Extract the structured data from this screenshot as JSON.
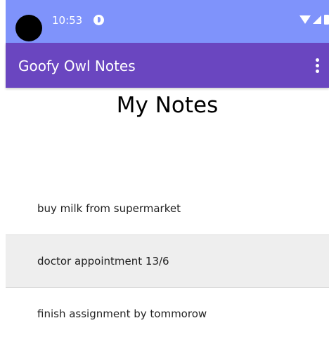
{
  "status_bar": {
    "time": "10:53",
    "icons": [
      "camera-cutout",
      "app-notification-icon",
      "wifi-icon",
      "signal-icon",
      "battery-icon"
    ]
  },
  "app_bar": {
    "title": "Goofy Owl Notes",
    "overflow_icon": "more-vert-icon"
  },
  "page": {
    "title": "My Notes"
  },
  "notes": [
    {
      "text": "buy milk from supermarket",
      "selected": false
    },
    {
      "text": "doctor appointment 13/6",
      "selected": true
    },
    {
      "text": "finish assignment by tommorow",
      "selected": false
    }
  ],
  "colors": {
    "status_bar": "#7f93fb",
    "app_bar": "#6a46c0",
    "selected_row": "#eeeeee",
    "background": "#ffffff"
  }
}
